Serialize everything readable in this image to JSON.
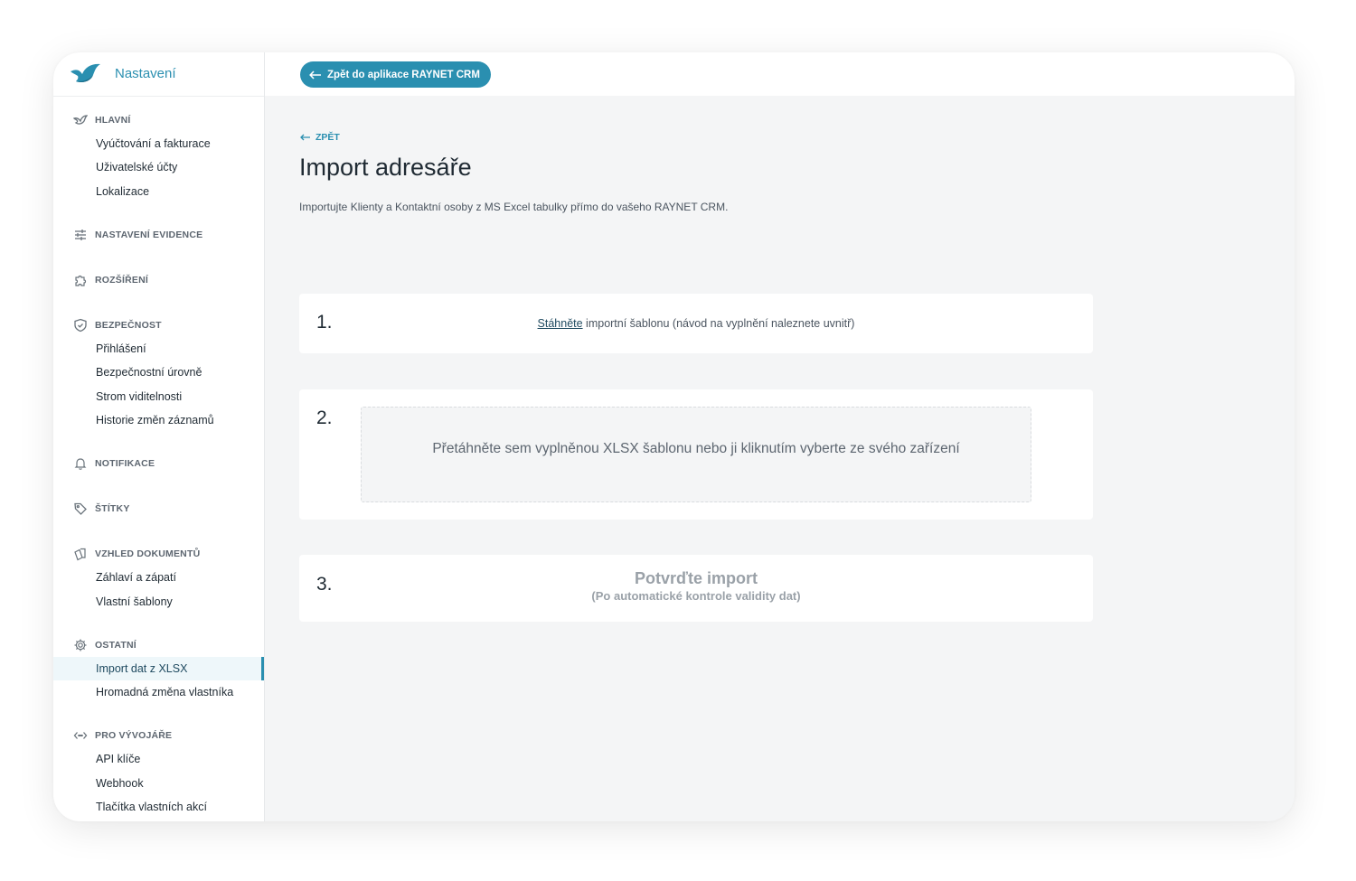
{
  "app": {
    "title": "Nastavení"
  },
  "topbar": {
    "back_to_app": "Zpět do aplikace RAYNET CRM"
  },
  "sidebar": {
    "sections": [
      {
        "label": "HLAVNÍ",
        "icon": "bird-icon",
        "items": [
          "Vyúčtování a fakturace",
          "Uživatelské účty",
          "Lokalizace"
        ]
      },
      {
        "label": "NASTAVENÍ EVIDENCE",
        "icon": "sliders-icon",
        "items": []
      },
      {
        "label": "ROZŠÍŘENÍ",
        "icon": "puzzle-icon",
        "items": []
      },
      {
        "label": "BEZPEČNOST",
        "icon": "shield-icon",
        "items": [
          "Přihlášení",
          "Bezpečnostní úrovně",
          "Strom viditelnosti",
          "Historie změn záznamů"
        ]
      },
      {
        "label": "NOTIFIKACE",
        "icon": "bell-icon",
        "items": []
      },
      {
        "label": "ŠTÍTKY",
        "icon": "tag-icon",
        "items": []
      },
      {
        "label": "VZHLED DOKUMENTŮ",
        "icon": "documents-icon",
        "items": [
          "Záhlaví a zápatí",
          "Vlastní šablony"
        ]
      },
      {
        "label": "OSTATNÍ",
        "icon": "gear-icon",
        "items": [
          "Import dat z XLSX",
          "Hromadná změna vlastníka"
        ]
      },
      {
        "label": "PRO VÝVOJÁŘE",
        "icon": "code-icon",
        "items": [
          "API klíče",
          "Webhook",
          "Tlačítka vlastních akcí"
        ]
      }
    ],
    "active_item": "Import dat z XLSX"
  },
  "main": {
    "back_label": "ZPĚT",
    "title": "Import adresáře",
    "subtitle": "Importujte Klienty a Kontaktní osoby z MS Excel tabulky přímo do vašeho RAYNET CRM.",
    "step1": {
      "number": "1.",
      "link_text": "Stáhněte",
      "text": " importní šablonu (návod na vyplnění naleznete uvnitř)"
    },
    "step2": {
      "number": "2.",
      "dropzone_text": "Přetáhněte sem vyplněnou XLSX šablonu nebo ji kliknutím vyberte ze svého zařízení"
    },
    "step3": {
      "number": "3.",
      "title": "Potvrďte import",
      "note": "(Po automatické kontrole validity dat)"
    }
  },
  "colors": {
    "accent": "#2a8fb0",
    "background": "#f4f5f6",
    "disabled_text": "#9aa1a8"
  }
}
